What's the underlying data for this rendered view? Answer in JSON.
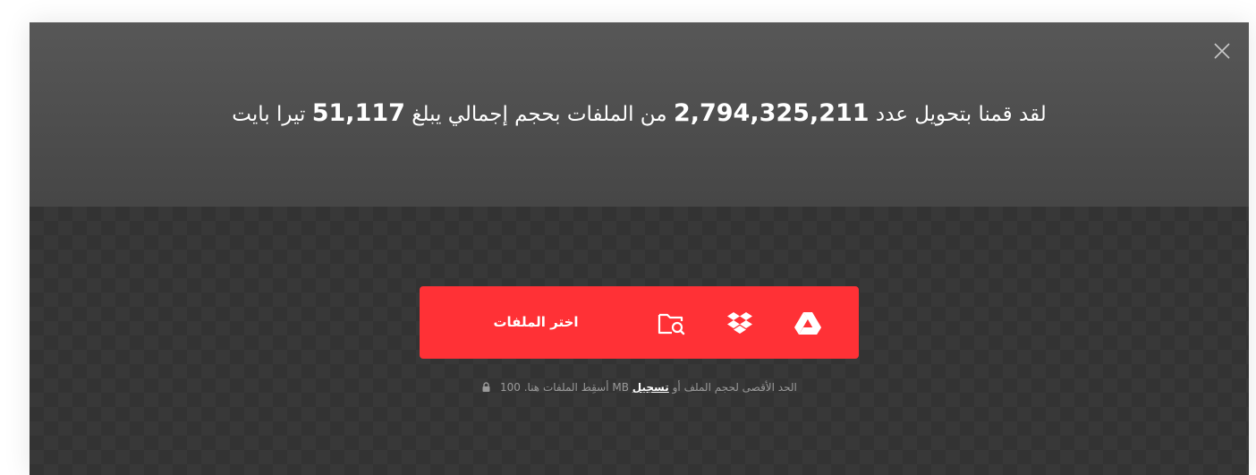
{
  "header": {
    "headline_part1": "لقد قمنا بتحويل عدد",
    "files_count": "2,794,325,211",
    "headline_part2": "من الملفات بحجم إجمالي يبلغ",
    "total_size": "51,117",
    "headline_part3": "تيرا بايت",
    "close_icon": "close-icon"
  },
  "upload": {
    "choose_label": "اختر الملفات",
    "sources": [
      "folder-search-icon",
      "dropbox-icon",
      "google-drive-icon"
    ],
    "accent_color": "#ff3136"
  },
  "info": {
    "limit_text": "الحد الأقصى لحجم الملف",
    "or_text": "أو",
    "signup_label": "تسجيل",
    "size_value": "100",
    "size_unit": "MB",
    "drop_text": "أسقِط الملفات هنا.",
    "lock_icon": "lock-icon"
  }
}
